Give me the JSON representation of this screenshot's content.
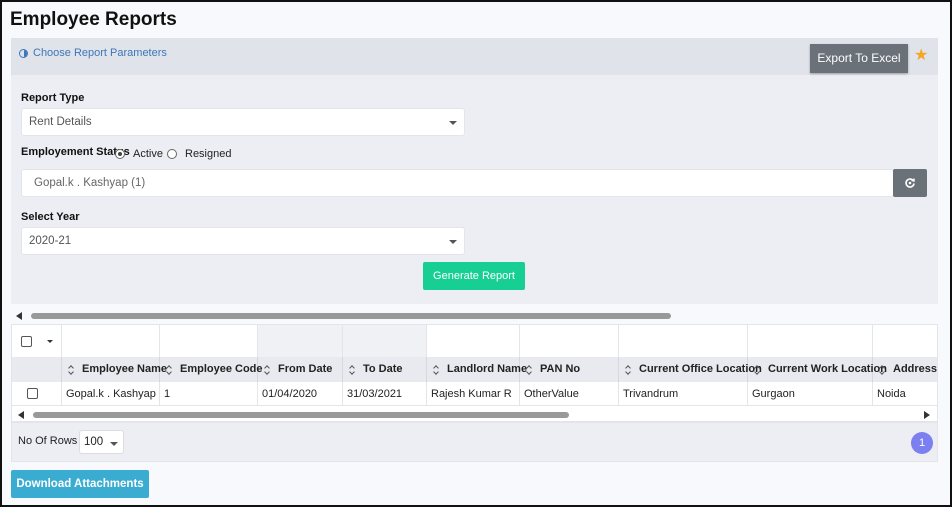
{
  "page": {
    "title": "Employee Reports"
  },
  "params": {
    "toggle_label": "Choose Report Parameters",
    "export_label": "Export To Excel",
    "report_type": {
      "label": "Report Type",
      "value": "Rent Details"
    },
    "employment_status": {
      "label": "Employement Status",
      "options": [
        {
          "label": "Active",
          "checked": true
        },
        {
          "label": "Resigned",
          "checked": false
        }
      ]
    },
    "employee_selector": {
      "value": "Gopal.k . Kashyap (1)"
    },
    "select_year": {
      "label": "Select Year",
      "value": "2020-21"
    },
    "generate_label": "Generate Report"
  },
  "grid": {
    "columns": [
      "Employee Name",
      "Employee Code",
      "From Date",
      "To Date",
      "Landlord Name",
      "PAN No",
      "Current Office Location",
      "Current Work Location",
      "Address"
    ],
    "rows": [
      [
        "Gopal.k . Kashyap",
        "1",
        "01/04/2020",
        "31/03/2021",
        "Rajesh Kumar R",
        "OtherValue",
        "Trivandrum",
        "Gurgaon",
        "Noida"
      ]
    ]
  },
  "footer": {
    "rows_label": "No Of Rows :",
    "rows_value": "100",
    "current_page": "1",
    "download_label": "Download Attachments"
  },
  "colors": {
    "accent_green": "#17cf93",
    "accent_blue": "#3aacd2",
    "page_badge": "#7b7ff0",
    "star": "#f5a623"
  }
}
